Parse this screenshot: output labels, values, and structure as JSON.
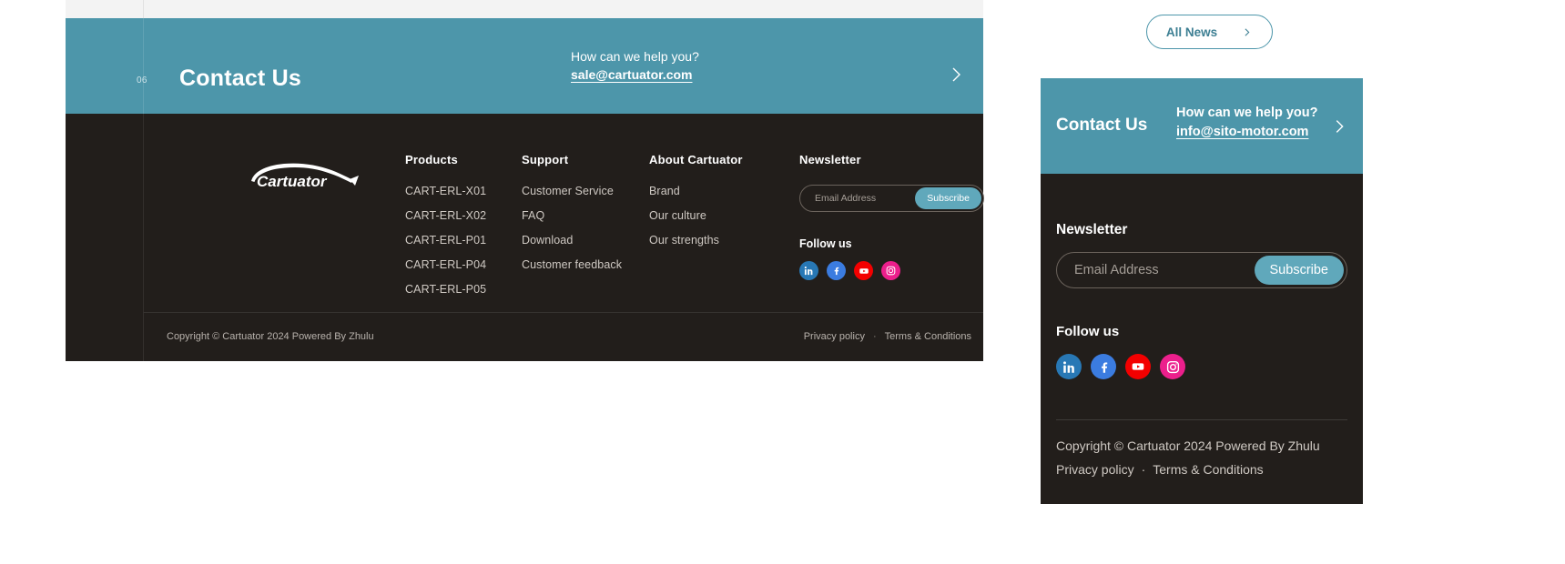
{
  "desktop": {
    "contact": {
      "number": "06",
      "title": "Contact Us",
      "help_text": "How can we help you?",
      "email": "sale@cartuator.com",
      "arrow_icon": "chevron-right-icon"
    },
    "logo": {
      "name": "Cartuator",
      "icon": "cartuator-car-logo"
    },
    "columns": [
      {
        "heading": "Products",
        "links": [
          "CART-ERL-X01",
          "CART-ERL-X02",
          "CART-ERL-P01",
          "CART-ERL-P04",
          "CART-ERL-P05"
        ]
      },
      {
        "heading": "Support",
        "links": [
          "Customer Service",
          "FAQ",
          "Download",
          "Customer feedback"
        ]
      },
      {
        "heading": "About Cartuator",
        "links": [
          "Brand",
          "Our culture",
          "Our strengths"
        ]
      }
    ],
    "newsletter": {
      "heading": "Newsletter",
      "placeholder": "Email Address",
      "value": "",
      "button": "Subscribe"
    },
    "follow": {
      "heading": "Follow us",
      "socials": [
        "linkedin-icon",
        "facebook-icon",
        "youtube-icon",
        "instagram-icon"
      ]
    },
    "bottom": {
      "copyright": "Copyright © Cartuator 2024  Powered By Zhulu",
      "privacy": "Privacy policy",
      "separator": "·",
      "terms": "Terms & Conditions"
    }
  },
  "mobile": {
    "all_news": {
      "label": "All News",
      "icon": "chevron-right-icon"
    },
    "contact": {
      "title": "Contact Us",
      "help_text": "How can we help you?",
      "email": "info@sito-motor.com",
      "arrow_icon": "chevron-right-icon"
    },
    "newsletter": {
      "heading": "Newsletter",
      "placeholder": "Email Address",
      "value": "",
      "button": "Subscribe"
    },
    "follow": {
      "heading": "Follow us",
      "socials": [
        "linkedin-icon",
        "facebook-icon",
        "youtube-icon",
        "instagram-icon"
      ]
    },
    "bottom": {
      "copyright": "Copyright © Cartuator 2024 Powered By Zhulu",
      "privacy": "Privacy policy",
      "separator": "·",
      "terms": "Terms & Conditions"
    }
  },
  "colors": {
    "teal": "#4d96aa",
    "teal_button": "#60a8bb",
    "dark": "#221e1b",
    "linkedin": "#2878b5",
    "facebook": "#3b7ce0",
    "youtube": "#f30000",
    "instagram": "#ec1f8c"
  }
}
